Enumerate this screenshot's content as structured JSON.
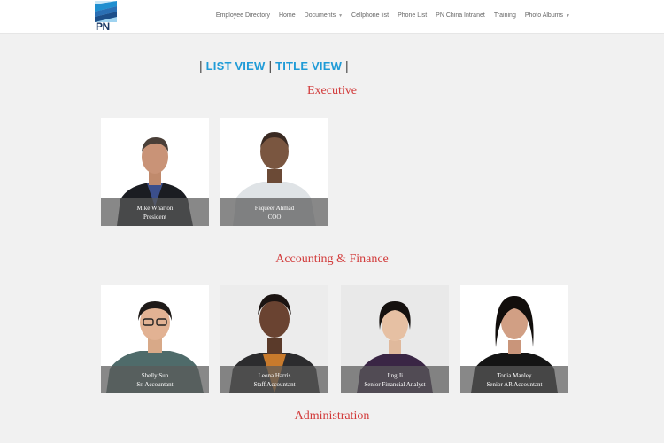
{
  "header": {
    "logo_text": "PN",
    "nav": [
      {
        "label": "Employee Directory"
      },
      {
        "label": "Home"
      },
      {
        "label": "Documents",
        "has_dropdown": true
      },
      {
        "label": "Cellphone list"
      },
      {
        "label": "Phone List"
      },
      {
        "label": "PN China Intranet"
      },
      {
        "label": "Training"
      },
      {
        "label": "Photo Albums",
        "has_dropdown": true
      }
    ]
  },
  "views": {
    "list_view": "LIST VIEW",
    "title_view": "TITLE VIEW",
    "separator": "|"
  },
  "sections": [
    {
      "title": "Executive",
      "people": [
        {
          "name": "Mike Wharton",
          "title": "President"
        },
        {
          "name": "Faqueer Ahmad",
          "title": "COO"
        }
      ]
    },
    {
      "title": "Accounting & Finance",
      "people": [
        {
          "name": "Shelly Sun",
          "title": "Sr. Accountant"
        },
        {
          "name": "Leona Harris",
          "title": "Staff Accountant"
        },
        {
          "name": "Jing Ji",
          "title": "Senior Financial Analyst"
        },
        {
          "name": "Tonia Manley",
          "title": "Senior AR Accountant"
        }
      ]
    },
    {
      "title": "Administration",
      "people": []
    }
  ],
  "colors": {
    "accent_link": "#1f9bd7",
    "section_title": "#d23b3b",
    "logo_blue": "#1c4f8a",
    "logo_light": "#5aa9dd"
  }
}
